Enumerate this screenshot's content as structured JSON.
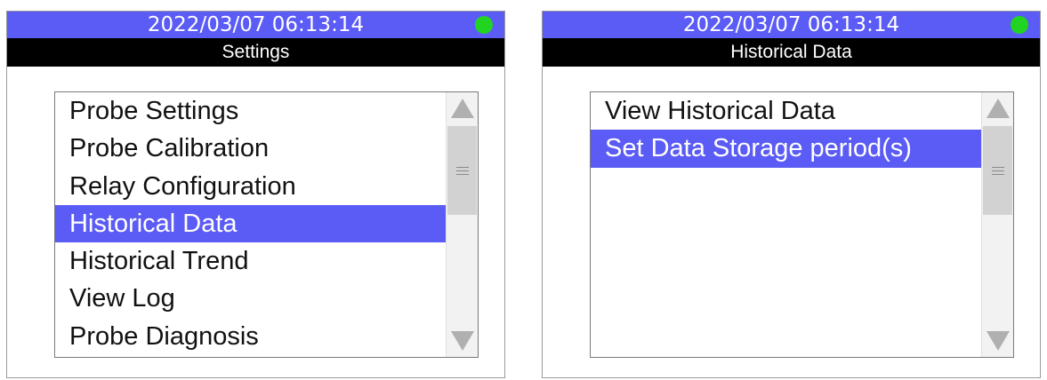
{
  "screens": [
    {
      "status": {
        "datetime": "2022/03/07 06:13:14",
        "indicator_color": "#22d422"
      },
      "title": "Settings",
      "items": [
        {
          "label": "Probe Settings",
          "selected": false
        },
        {
          "label": "Probe Calibration",
          "selected": false
        },
        {
          "label": "Relay Configuration",
          "selected": false
        },
        {
          "label": "Historical Data",
          "selected": true
        },
        {
          "label": "Historical Trend",
          "selected": false
        },
        {
          "label": "View Log",
          "selected": false
        },
        {
          "label": "Probe Diagnosis",
          "selected": false
        }
      ],
      "scrollbar": {
        "up_icon": "triangle-up",
        "down_icon": "triangle-down",
        "thumb_icon": "grip-lines"
      }
    },
    {
      "status": {
        "datetime": "2022/03/07 06:13:14",
        "indicator_color": "#22d422"
      },
      "title": "Historical Data",
      "items": [
        {
          "label": "View Historical Data",
          "selected": false
        },
        {
          "label": "Set Data Storage period(s)",
          "selected": true
        }
      ],
      "scrollbar": {
        "up_icon": "triangle-up",
        "down_icon": "triangle-down",
        "thumb_icon": "grip-lines"
      }
    }
  ],
  "colors": {
    "accent": "#5b5bf5",
    "title_bar": "#000000",
    "status_ok": "#22d422"
  }
}
